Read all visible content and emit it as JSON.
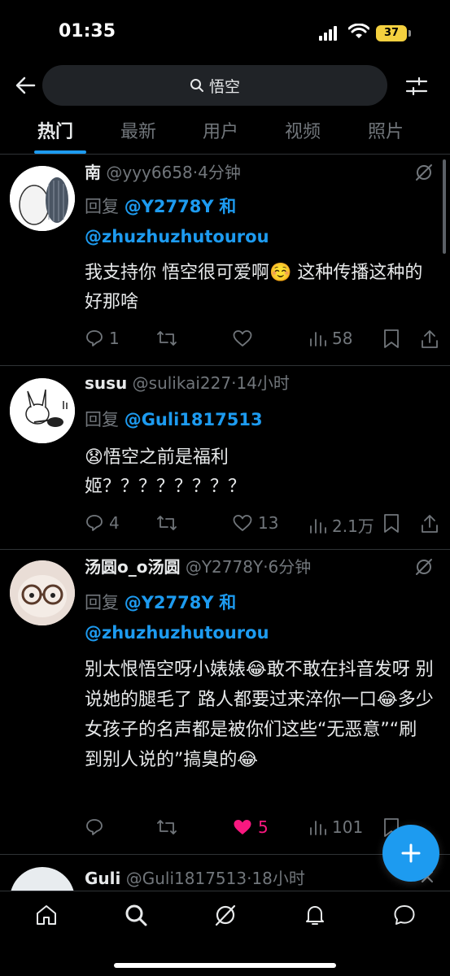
{
  "status_bar": {
    "time": "01:35",
    "battery": "37"
  },
  "search": {
    "query": "悟空"
  },
  "tabs": [
    "热门",
    "最新",
    "用户",
    "视频",
    "照片"
  ],
  "tweets": [
    {
      "name": "南",
      "handle": "@yyy6658",
      "dot": "·",
      "time": "4分钟",
      "reply_prefix": "回复",
      "mention1": "@Y2778Y",
      "joiner": "和",
      "mention2": "@zhuzhuzhutourou",
      "text": "我支持你 悟空很可爱啊☺️ 这种传播这种的好那啥",
      "replies": "1",
      "reposts": "",
      "likes": "",
      "views": "58"
    },
    {
      "name": "susu",
      "handle": "@sulikai227",
      "dot": "·",
      "time": "14小时",
      "reply_prefix": "回复",
      "mention1": "@Guli1817513",
      "text": "😧悟空之前是福利姬？？？？？？？？",
      "replies": "4",
      "reposts": "",
      "likes": "13",
      "views": "2.1万"
    },
    {
      "name": "汤圆o_o汤圆",
      "handle": "@Y2778Y",
      "dot": "·",
      "time": "6分钟",
      "reply_prefix": "回复",
      "mention1": "@Y2778Y",
      "joiner": "和",
      "mention2": "@zhuzhuzhutourou",
      "text": "别太恨悟空呀小婊婊😂敢不敢在抖音发呀 别说她的腿毛了 路人都要过来淬你一口😂多少女孩子的名声都是被你们这些“无恶意”“刷到别人说的”搞臭的😂",
      "replies": "",
      "reposts": "",
      "likes": "5",
      "views": "101"
    },
    {
      "name": "Guli",
      "handle": "@Guli1817513",
      "dot": "·",
      "time": "18小时"
    }
  ]
}
